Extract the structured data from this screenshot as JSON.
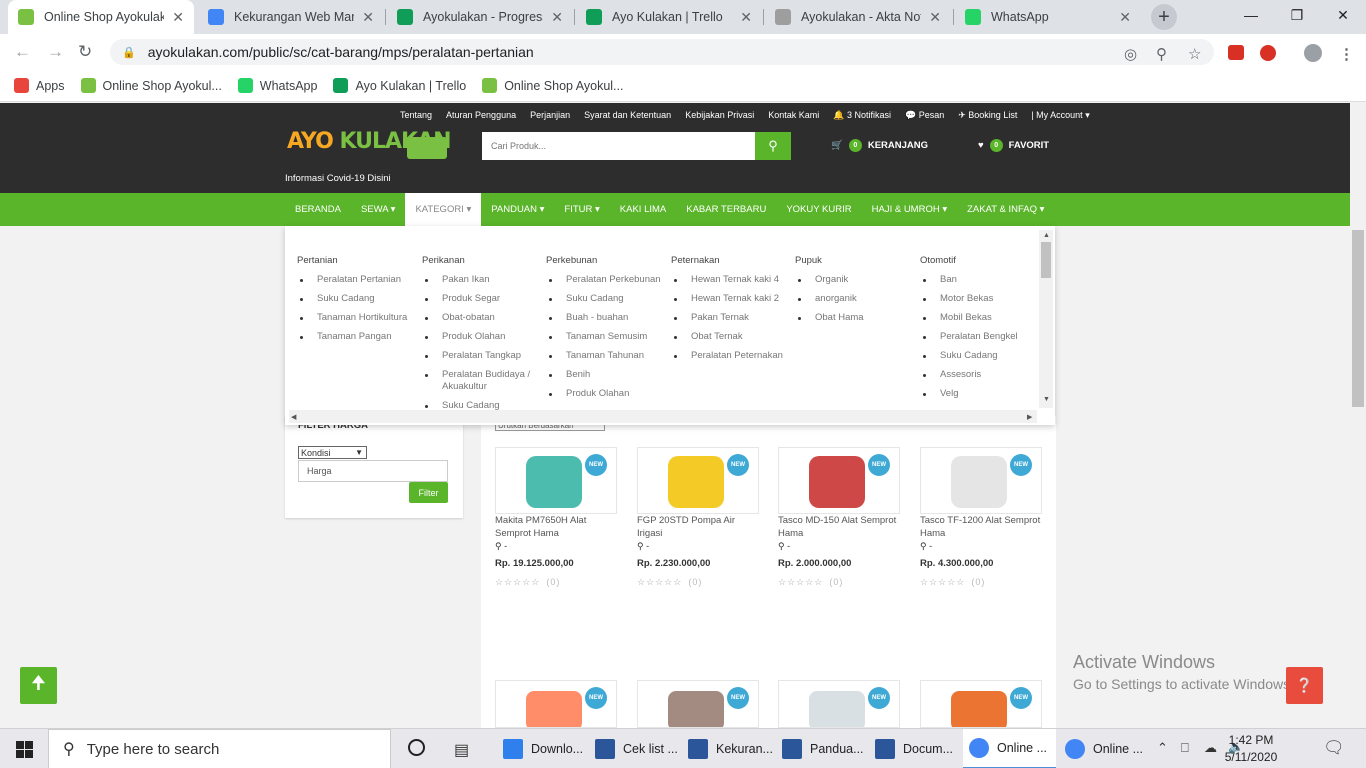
{
  "browser": {
    "tabs": [
      {
        "title": "Online Shop Ayokulaka",
        "color": "#7ac143",
        "active": true
      },
      {
        "title": "Kekurangan Web Marke",
        "color": "#4285f4",
        "active": false
      },
      {
        "title": "Ayokulakan - Progress",
        "color": "#0f9d58",
        "active": false
      },
      {
        "title": "Ayo Kulakan | Trello",
        "color": "#0f9d58",
        "active": false
      },
      {
        "title": "Ayokulakan - Akta Nota",
        "color": "#9e9e9e",
        "active": false
      },
      {
        "title": "WhatsApp",
        "color": "#25d366",
        "active": false
      }
    ],
    "new_tab": "+",
    "url": "ayokulakan.com/public/sc/cat-barang/mps/peralatan-pertanian",
    "bookmarks": [
      {
        "label": "Apps",
        "color": "#e8453c"
      },
      {
        "label": "Online Shop Ayokul...",
        "color": "#7ac143"
      },
      {
        "label": "WhatsApp",
        "color": "#25d366"
      },
      {
        "label": "Ayo Kulakan | Trello",
        "color": "#0f9d58"
      },
      {
        "label": "Online Shop Ayokul...",
        "color": "#7ac143"
      }
    ]
  },
  "header": {
    "topnav": [
      "Tentang",
      "Aturan Pengguna",
      "Perjanjian",
      "Syarat dan Ketentuan",
      "Kebijakan Privasi",
      "Kontak Kami",
      "🔔 3 Notifikasi",
      "💬 Pesan",
      "✈ Booking List",
      "| My Account ▾"
    ],
    "logo_part1": "AYO ",
    "logo_part2": "KULAKAN",
    "covid": "Informasi Covid-19 Disini",
    "search_placeholder": "Cari Produk...",
    "cart_count": "0",
    "cart_label": "KERANJANG",
    "fav_count": "0",
    "fav_label": "FAVORIT"
  },
  "mainnav": [
    "BERANDA",
    "SEWA ▾",
    "KATEGORI ▾",
    "PANDUAN ▾",
    "FITUR ▾",
    "KAKI LIMA",
    "KABAR TERBARU",
    "YOKUY KURIR",
    "HAJI & UMROH ▾",
    "ZAKAT & INFAQ ▾"
  ],
  "mega_menu": [
    {
      "title": "Pertanian",
      "items": [
        "Peralatan Pertanian",
        "Suku Cadang",
        "Tanaman Hortikultura",
        "Tanaman Pangan"
      ]
    },
    {
      "title": "Perikanan",
      "items": [
        "Pakan Ikan",
        "Produk Segar",
        "Obat-obatan",
        "Produk Olahan",
        "Peralatan Tangkap",
        "Peralatan Budidaya / Akuakultur",
        "Suku Cadang"
      ]
    },
    {
      "title": "Perkebunan",
      "items": [
        "Peralatan Perkebunan",
        "Suku Cadang",
        "Buah - buahan",
        "Tanaman Semusim",
        "Tanaman Tahunan",
        "Benih",
        "Produk Olahan"
      ]
    },
    {
      "title": "Peternakan",
      "items": [
        "Hewan Ternak kaki 4",
        "Hewan Ternak kaki 2",
        "Pakan Ternak",
        "Obat Ternak",
        "Peralatan Peternakan"
      ]
    },
    {
      "title": "Pupuk",
      "items": [
        "Organik",
        "anorganik",
        "Obat Hama"
      ]
    },
    {
      "title": "Otomotif",
      "items": [
        "Ban",
        "Motor Bekas",
        "Mobil Bekas",
        "Peralatan Bengkel",
        "Suku Cadang",
        "Assesoris",
        "Velg"
      ]
    }
  ],
  "filter": {
    "title": "FILTER HARGA",
    "kondisi": "Kondisi",
    "harga_placeholder": "Harga",
    "button": "Filter"
  },
  "sort": "Urutkan Berdasarkan",
  "products": [
    {
      "name": "Makita PM7650H Alat Semprot Hama",
      "loc": "-",
      "price": "Rp. 19.125.000,00",
      "stars": "☆☆☆☆☆",
      "reviews": "(0)",
      "badge": "NEW"
    },
    {
      "name": "FGP 20STD Pompa Air Irigasi",
      "loc": "-",
      "price": "Rp. 2.230.000,00",
      "stars": "☆☆☆☆☆",
      "reviews": "(0)",
      "badge": "NEW"
    },
    {
      "name": "Tasco MD-150 Alat Semprot Hama",
      "loc": "-",
      "price": "Rp. 2.000.000,00",
      "stars": "☆☆☆☆☆",
      "reviews": "(0)",
      "badge": "NEW"
    },
    {
      "name": "Tasco TF-1200 Alat Semprot Hama",
      "loc": "-",
      "price": "Rp. 4.300.000,00",
      "stars": "☆☆☆☆☆",
      "reviews": "(0)",
      "badge": "NEW"
    }
  ],
  "products_row2_badges": [
    "NEW",
    "NEW",
    "NEW",
    "NEW"
  ],
  "activate_windows": {
    "line1": "Activate Windows",
    "line2": "Go to Settings to activate Windows."
  },
  "taskbar": {
    "search": "Type here to search",
    "apps": [
      {
        "label": "Downlo...",
        "color": "#2f80ed"
      },
      {
        "label": "Cek list ...",
        "color": "#2b579a"
      },
      {
        "label": "Kekuran...",
        "color": "#2b579a"
      },
      {
        "label": "Pandua...",
        "color": "#2b579a"
      },
      {
        "label": "Docum...",
        "color": "#2b579a"
      },
      {
        "label": "Online ...",
        "color": "#4285f4"
      },
      {
        "label": "Online ...",
        "color": "#4285f4"
      }
    ],
    "time": "1:42 PM",
    "date": "5/11/2020"
  }
}
